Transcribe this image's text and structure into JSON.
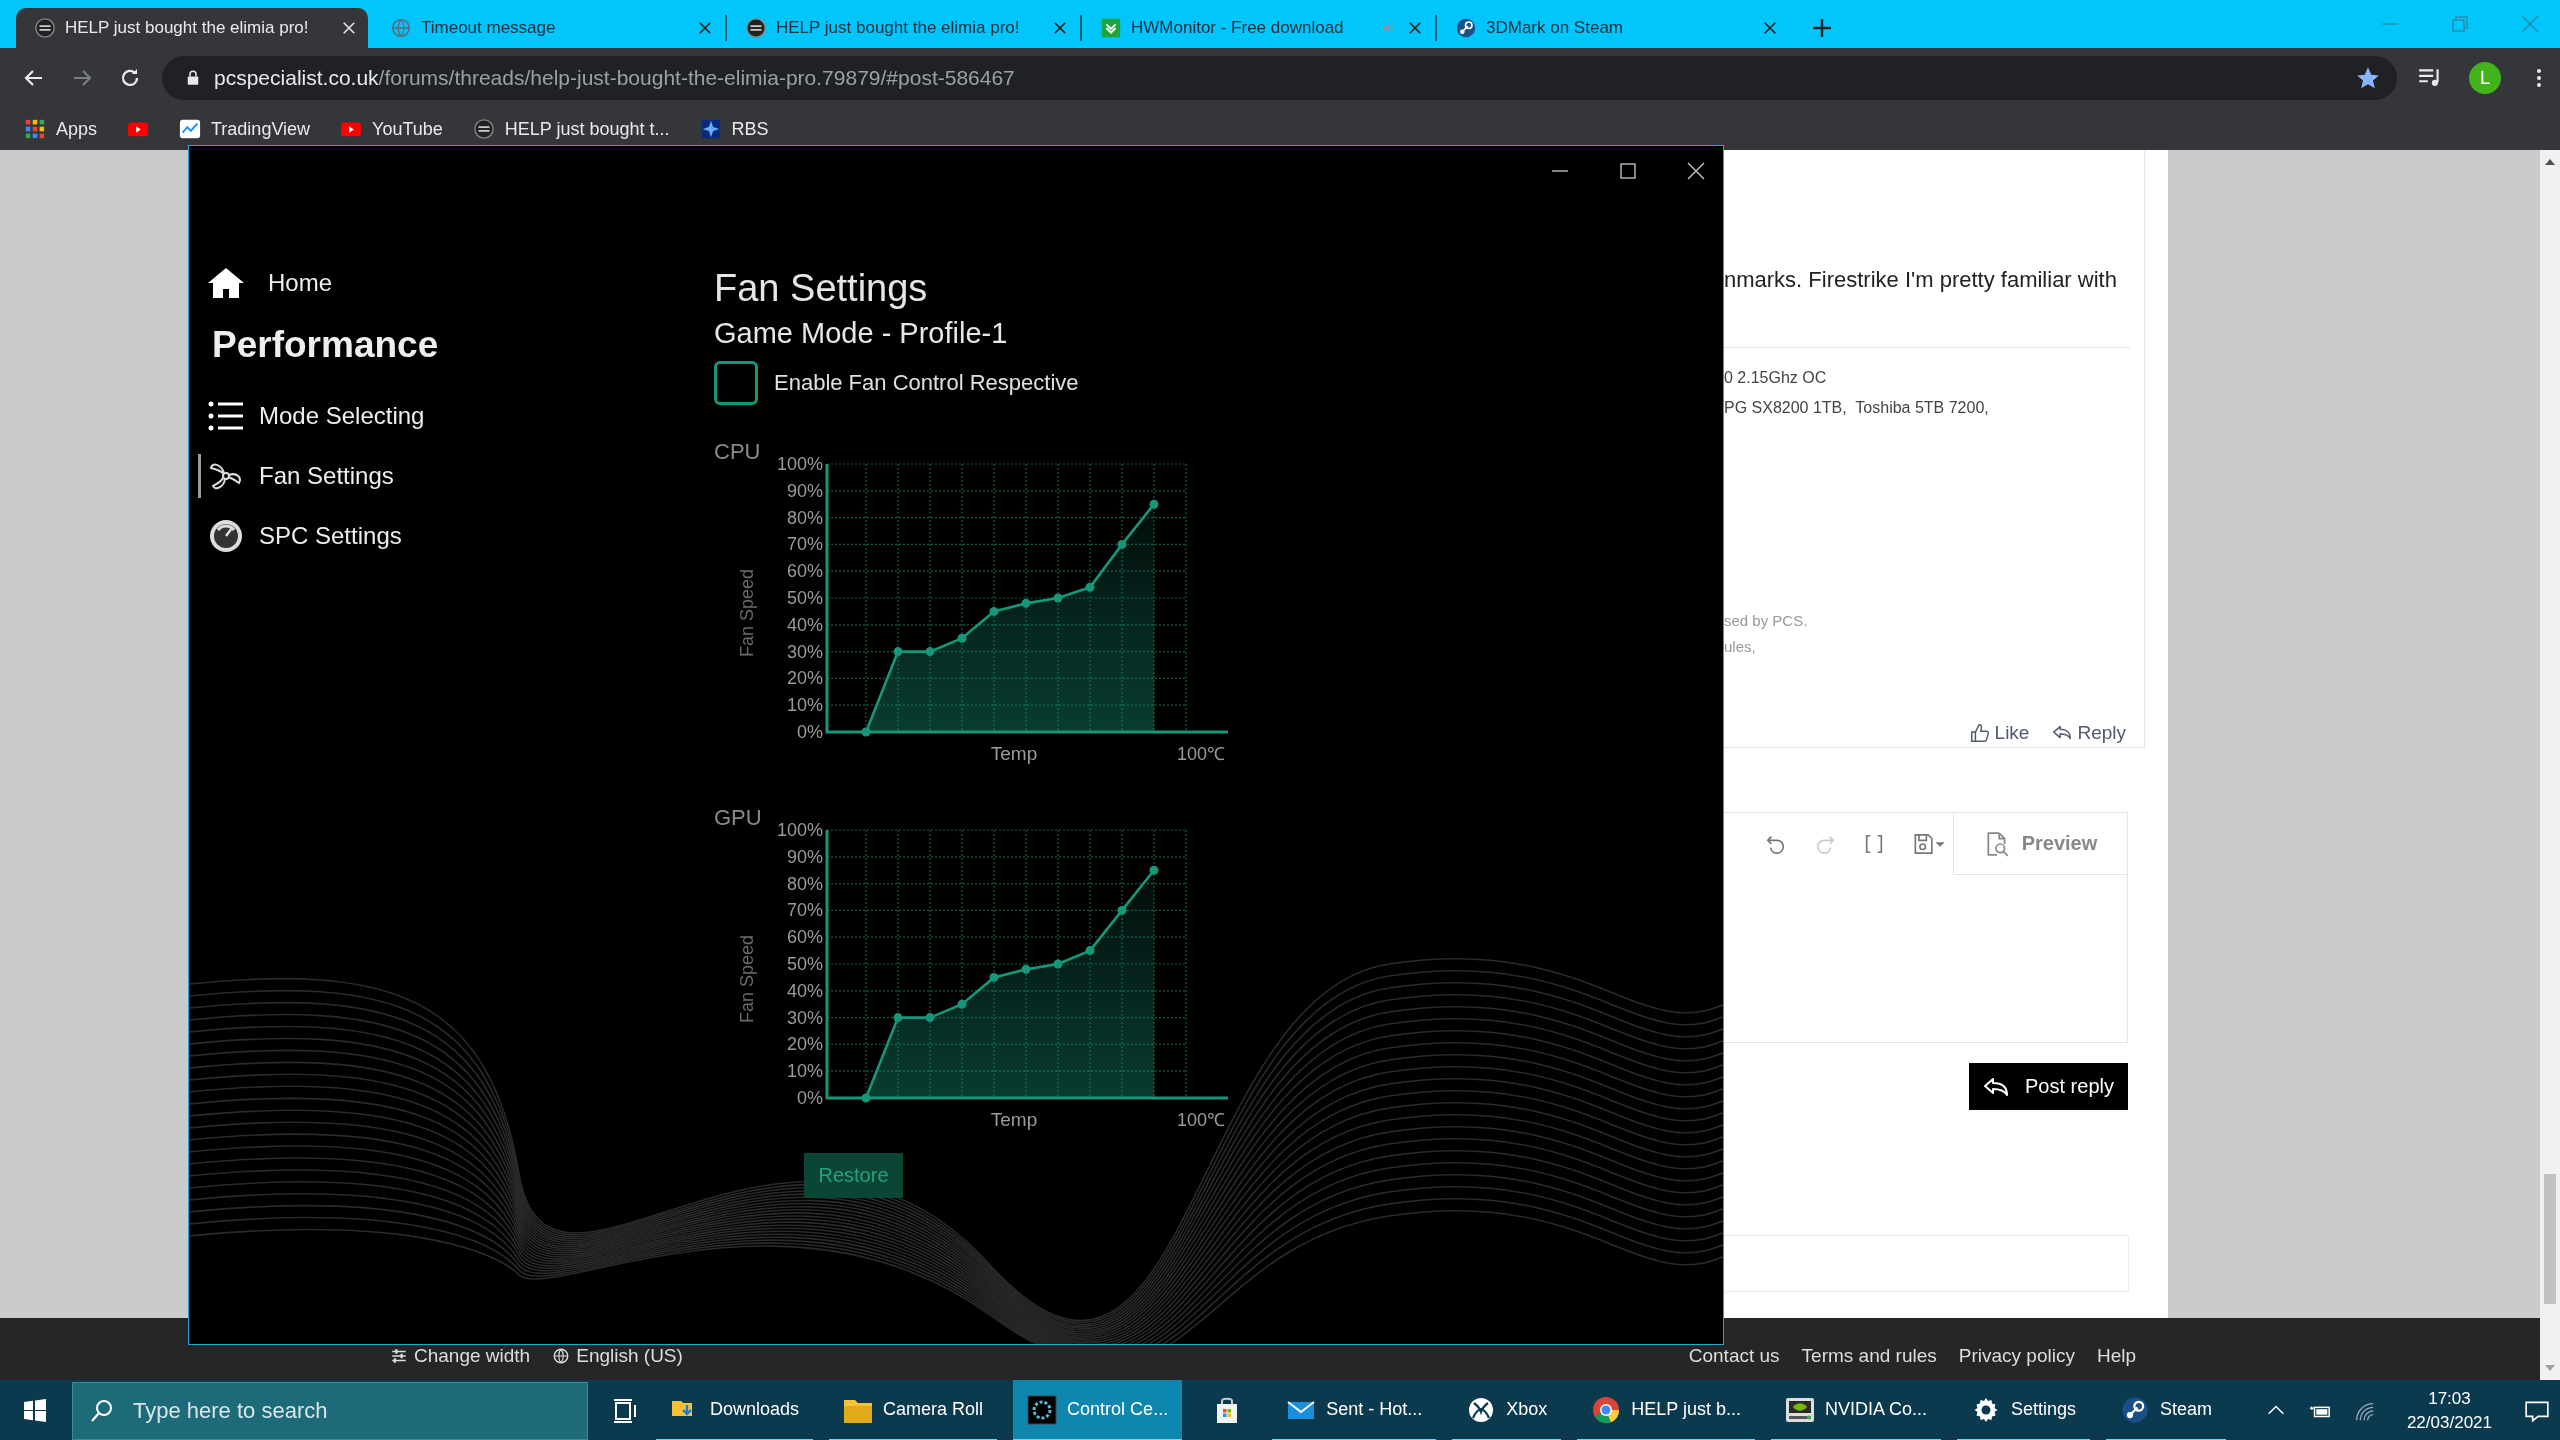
{
  "browser": {
    "tabs": [
      {
        "title": "HELP just bought the elimia pro!",
        "kind": "forum",
        "selected": true,
        "audio": false
      },
      {
        "title": "Timeout message",
        "kind": "globe",
        "selected": false,
        "audio": false
      },
      {
        "title": "HELP just bought the elimia pro!",
        "kind": "forum",
        "selected": false,
        "audio": false
      },
      {
        "title": "HWMonitor - Free download",
        "kind": "hwmonitor",
        "selected": false,
        "audio": true
      },
      {
        "title": "3DMark on Steam",
        "kind": "steam",
        "selected": false,
        "audio": false
      }
    ],
    "address": {
      "host": "pcspecialist.co.uk",
      "path": "/forums/threads/help-just-bought-the-elimia-pro.79879/#post-586467"
    },
    "profile_initial": "L",
    "bookmarks": [
      {
        "label": "Apps",
        "kind": "apps"
      },
      {
        "kind": "youtube"
      },
      {
        "label": "TradingView",
        "kind": "tradingview"
      },
      {
        "label": "YouTube",
        "kind": "youtube"
      },
      {
        "label": "HELP just bought t...",
        "kind": "forum"
      },
      {
        "label": "RBS",
        "kind": "rbs"
      }
    ]
  },
  "forum": {
    "post_text": "nmarks. Firestrike I'm pretty familiar with",
    "signature_lines": [
      "0 2.15Ghz OC",
      "PG SX8200 1TB,  Toshiba 5TB 7200,"
    ],
    "notes": [
      "sed by PCS.",
      "ules,"
    ],
    "actions": [
      {
        "label": "Like",
        "kind": "like"
      },
      {
        "label": "Reply",
        "kind": "reply"
      }
    ],
    "editor": {
      "preview": "Preview"
    },
    "post_reply": "Post reply",
    "footer_left": [
      {
        "label": "Change width",
        "kind": "sliders"
      },
      {
        "label": "English (US)",
        "kind": "globe"
      }
    ],
    "footer_links": [
      "Contact us",
      "Terms and rules",
      "Privacy policy",
      "Help"
    ]
  },
  "app": {
    "sidebar": {
      "home": "Home",
      "section": "Performance",
      "items": [
        {
          "label": "Mode Selecting",
          "kind": "list",
          "selected": false
        },
        {
          "label": "Fan Settings",
          "kind": "fan",
          "selected": true
        },
        {
          "label": "SPC Settings",
          "kind": "gauge",
          "selected": false
        }
      ]
    },
    "heading": "Fan Settings",
    "subheading": "Game Mode - Profile-1",
    "fan_control": {
      "label": "Enable Fan Control Respective",
      "checked": false
    },
    "charts": [
      {
        "chart_data": {
          "type": "area",
          "title": "CPU",
          "xlabel": "Temp",
          "ylabel": "Fan Speed",
          "annotations": [
            {
              "text": "100℃"
            }
          ],
          "grid": true,
          "ylim": [
            0,
            100
          ],
          "yticks": [
            {
              "value": 0,
              "label": "0%"
            },
            {
              "value": 10,
              "label": "10%"
            },
            {
              "value": 20,
              "label": "20%"
            },
            {
              "value": 30,
              "label": "30%"
            },
            {
              "value": 40,
              "label": "40%"
            },
            {
              "value": 50,
              "label": "50%"
            },
            {
              "value": 60,
              "label": "60%"
            },
            {
              "value": 70,
              "label": "70%"
            },
            {
              "value": 80,
              "label": "80%"
            },
            {
              "value": 90,
              "label": "90%"
            },
            {
              "value": 100,
              "label": "100%"
            }
          ],
          "series": [
            {
              "color": "#16977a",
              "values": [
                0,
                30,
                30,
                35,
                45,
                48,
                50,
                54,
                70,
                85
              ]
            }
          ]
        }
      },
      {
        "chart_data": {
          "type": "area",
          "title": "GPU",
          "xlabel": "Temp",
          "ylabel": "Fan Speed",
          "annotations": [
            {
              "text": "100℃"
            }
          ],
          "grid": true,
          "ylim": [
            0,
            100
          ],
          "yticks": [
            {
              "value": 0,
              "label": "0%"
            },
            {
              "value": 10,
              "label": "10%"
            },
            {
              "value": 20,
              "label": "20%"
            },
            {
              "value": 30,
              "label": "30%"
            },
            {
              "value": 40,
              "label": "40%"
            },
            {
              "value": 50,
              "label": "50%"
            },
            {
              "value": 60,
              "label": "60%"
            },
            {
              "value": 70,
              "label": "70%"
            },
            {
              "value": 80,
              "label": "80%"
            },
            {
              "value": 90,
              "label": "90%"
            },
            {
              "value": 100,
              "label": "100%"
            }
          ],
          "series": [
            {
              "color": "#16977a",
              "values": [
                0,
                30,
                30,
                35,
                45,
                48,
                50,
                55,
                70,
                85
              ]
            }
          ]
        }
      }
    ],
    "restore": "Restore"
  },
  "taskbar": {
    "search_placeholder": "Type here to search",
    "items": [
      {
        "kind": "downloads",
        "label": "Downloads",
        "selected": false,
        "running": true
      },
      {
        "kind": "folder",
        "label": "Camera Roll",
        "selected": false,
        "running": true
      },
      {
        "kind": "controlcenter",
        "label": "Control Ce...",
        "selected": true,
        "running": true
      },
      {
        "kind": "store",
        "selected": false,
        "running": false
      },
      {
        "kind": "mail",
        "label": "Sent - Hot...",
        "selected": false,
        "running": true
      },
      {
        "kind": "xbox",
        "label": "Xbox",
        "selected": false,
        "running": true
      },
      {
        "kind": "chrome",
        "label": "HELP just b...",
        "selected": false,
        "running": true
      },
      {
        "kind": "nvidia",
        "label": "NVIDIA Co...",
        "selected": false,
        "running": true
      },
      {
        "kind": "settings",
        "label": "Settings",
        "selected": false,
        "running": true
      },
      {
        "kind": "steam",
        "label": "Steam",
        "selected": false,
        "running": true
      }
    ],
    "time": "17:03",
    "date": "22/03/2021"
  }
}
